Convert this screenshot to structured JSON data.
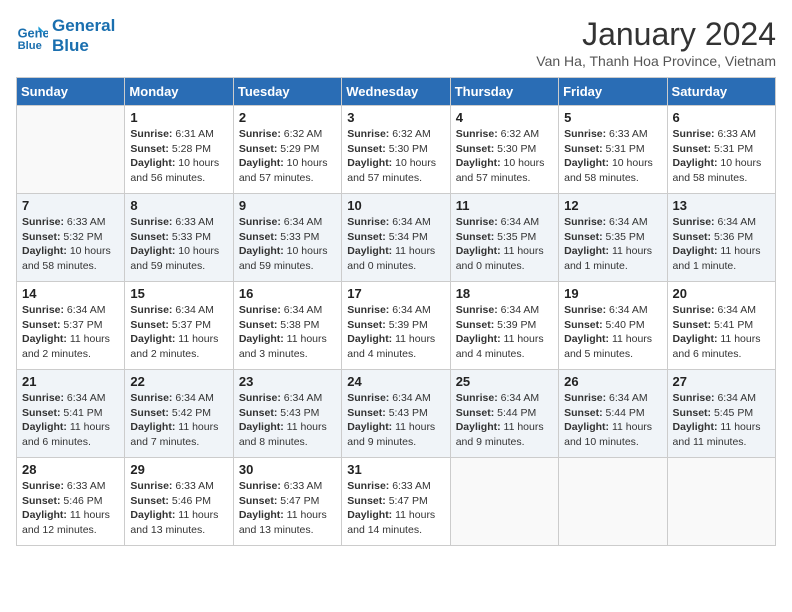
{
  "header": {
    "logo_line1": "General",
    "logo_line2": "Blue",
    "month_year": "January 2024",
    "location": "Van Ha, Thanh Hoa Province, Vietnam"
  },
  "days_of_week": [
    "Sunday",
    "Monday",
    "Tuesday",
    "Wednesday",
    "Thursday",
    "Friday",
    "Saturday"
  ],
  "weeks": [
    [
      {
        "day": "",
        "sunrise": "",
        "sunset": "",
        "daylight": ""
      },
      {
        "day": "1",
        "sunrise": "6:31 AM",
        "sunset": "5:28 PM",
        "daylight": "10 hours and 56 minutes."
      },
      {
        "day": "2",
        "sunrise": "6:32 AM",
        "sunset": "5:29 PM",
        "daylight": "10 hours and 57 minutes."
      },
      {
        "day": "3",
        "sunrise": "6:32 AM",
        "sunset": "5:30 PM",
        "daylight": "10 hours and 57 minutes."
      },
      {
        "day": "4",
        "sunrise": "6:32 AM",
        "sunset": "5:30 PM",
        "daylight": "10 hours and 57 minutes."
      },
      {
        "day": "5",
        "sunrise": "6:33 AM",
        "sunset": "5:31 PM",
        "daylight": "10 hours and 58 minutes."
      },
      {
        "day": "6",
        "sunrise": "6:33 AM",
        "sunset": "5:31 PM",
        "daylight": "10 hours and 58 minutes."
      }
    ],
    [
      {
        "day": "7",
        "sunrise": "6:33 AM",
        "sunset": "5:32 PM",
        "daylight": "10 hours and 58 minutes."
      },
      {
        "day": "8",
        "sunrise": "6:33 AM",
        "sunset": "5:33 PM",
        "daylight": "10 hours and 59 minutes."
      },
      {
        "day": "9",
        "sunrise": "6:34 AM",
        "sunset": "5:33 PM",
        "daylight": "10 hours and 59 minutes."
      },
      {
        "day": "10",
        "sunrise": "6:34 AM",
        "sunset": "5:34 PM",
        "daylight": "11 hours and 0 minutes."
      },
      {
        "day": "11",
        "sunrise": "6:34 AM",
        "sunset": "5:35 PM",
        "daylight": "11 hours and 0 minutes."
      },
      {
        "day": "12",
        "sunrise": "6:34 AM",
        "sunset": "5:35 PM",
        "daylight": "11 hours and 1 minute."
      },
      {
        "day": "13",
        "sunrise": "6:34 AM",
        "sunset": "5:36 PM",
        "daylight": "11 hours and 1 minute."
      }
    ],
    [
      {
        "day": "14",
        "sunrise": "6:34 AM",
        "sunset": "5:37 PM",
        "daylight": "11 hours and 2 minutes."
      },
      {
        "day": "15",
        "sunrise": "6:34 AM",
        "sunset": "5:37 PM",
        "daylight": "11 hours and 2 minutes."
      },
      {
        "day": "16",
        "sunrise": "6:34 AM",
        "sunset": "5:38 PM",
        "daylight": "11 hours and 3 minutes."
      },
      {
        "day": "17",
        "sunrise": "6:34 AM",
        "sunset": "5:39 PM",
        "daylight": "11 hours and 4 minutes."
      },
      {
        "day": "18",
        "sunrise": "6:34 AM",
        "sunset": "5:39 PM",
        "daylight": "11 hours and 4 minutes."
      },
      {
        "day": "19",
        "sunrise": "6:34 AM",
        "sunset": "5:40 PM",
        "daylight": "11 hours and 5 minutes."
      },
      {
        "day": "20",
        "sunrise": "6:34 AM",
        "sunset": "5:41 PM",
        "daylight": "11 hours and 6 minutes."
      }
    ],
    [
      {
        "day": "21",
        "sunrise": "6:34 AM",
        "sunset": "5:41 PM",
        "daylight": "11 hours and 6 minutes."
      },
      {
        "day": "22",
        "sunrise": "6:34 AM",
        "sunset": "5:42 PM",
        "daylight": "11 hours and 7 minutes."
      },
      {
        "day": "23",
        "sunrise": "6:34 AM",
        "sunset": "5:43 PM",
        "daylight": "11 hours and 8 minutes."
      },
      {
        "day": "24",
        "sunrise": "6:34 AM",
        "sunset": "5:43 PM",
        "daylight": "11 hours and 9 minutes."
      },
      {
        "day": "25",
        "sunrise": "6:34 AM",
        "sunset": "5:44 PM",
        "daylight": "11 hours and 9 minutes."
      },
      {
        "day": "26",
        "sunrise": "6:34 AM",
        "sunset": "5:44 PM",
        "daylight": "11 hours and 10 minutes."
      },
      {
        "day": "27",
        "sunrise": "6:34 AM",
        "sunset": "5:45 PM",
        "daylight": "11 hours and 11 minutes."
      }
    ],
    [
      {
        "day": "28",
        "sunrise": "6:33 AM",
        "sunset": "5:46 PM",
        "daylight": "11 hours and 12 minutes."
      },
      {
        "day": "29",
        "sunrise": "6:33 AM",
        "sunset": "5:46 PM",
        "daylight": "11 hours and 13 minutes."
      },
      {
        "day": "30",
        "sunrise": "6:33 AM",
        "sunset": "5:47 PM",
        "daylight": "11 hours and 13 minutes."
      },
      {
        "day": "31",
        "sunrise": "6:33 AM",
        "sunset": "5:47 PM",
        "daylight": "11 hours and 14 minutes."
      },
      {
        "day": "",
        "sunrise": "",
        "sunset": "",
        "daylight": ""
      },
      {
        "day": "",
        "sunrise": "",
        "sunset": "",
        "daylight": ""
      },
      {
        "day": "",
        "sunrise": "",
        "sunset": "",
        "daylight": ""
      }
    ]
  ],
  "labels": {
    "sunrise": "Sunrise:",
    "sunset": "Sunset:",
    "daylight": "Daylight:"
  }
}
